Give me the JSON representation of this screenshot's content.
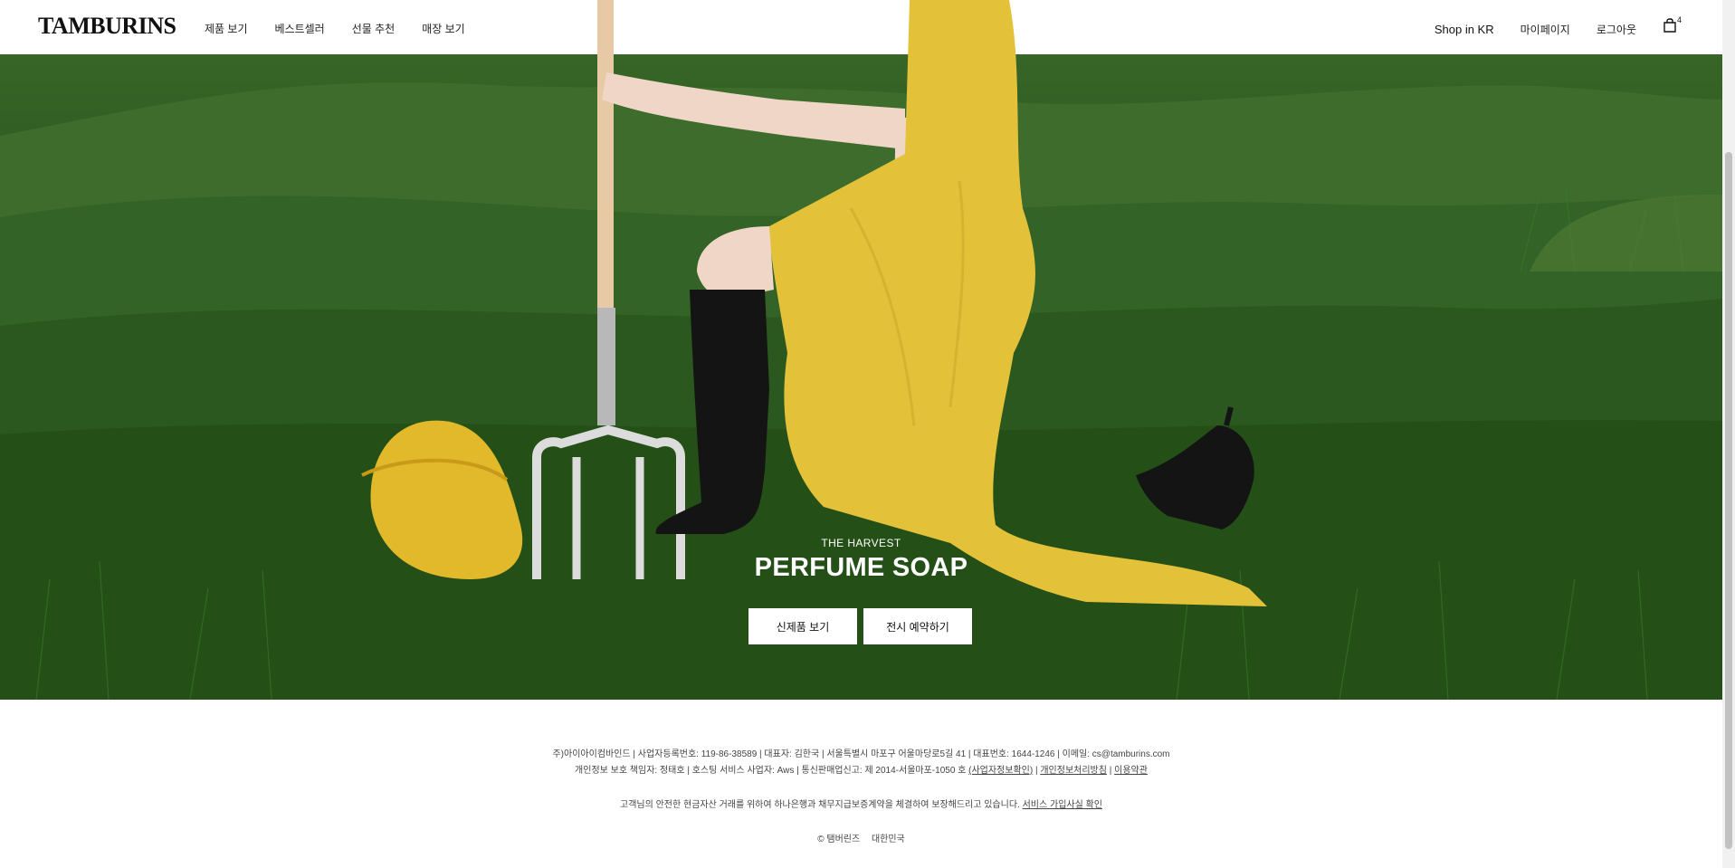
{
  "header": {
    "logo": "TAMBURINS",
    "nav": [
      "제품 보기",
      "베스트셀러",
      "선물 추천",
      "매장 보기"
    ],
    "shop_region": "Shop in KR",
    "mypage": "마이페이지",
    "logout": "로그아웃",
    "cart_count": "4"
  },
  "hero": {
    "eyebrow": "THE HARVEST",
    "headline": "PERFUME SOAP",
    "cta_primary": "신제품 보기",
    "cta_secondary": "전시 예약하기"
  },
  "footer": {
    "line1": "주)아이아이컴바인드 | 사업자등록번호: 119-86-38589 | 대표자: 김한국 | 서울특별시 마포구 어울마당로5길 41 | 대표번호: 1644-1246 | 이메일: cs@tamburins.com",
    "line2_text": "개인정보 보호 책임자: 정태호 | 호스팅 서비스 사업자: Aws | 통신판매업신고: 제 2014-서울마포-1050 호",
    "line2_link1": "(사업자정보확인)",
    "line2_link2": "개인정보처리방침",
    "line2_link3": "이용약관",
    "line3_text": "고객님의 안전한 현금자산 거래를 위하여 하나은행과 채무지급보증계약을 체결하여 보장해드리고 있습니다.",
    "line3_link": "서비스 가입사실 확인",
    "copyright": "© 탬버린즈",
    "country": "대한민국"
  },
  "colors": {
    "grass_dark": "#1f4a14",
    "grass_mid": "#2f5c22",
    "dress_yellow": "#e3c23a",
    "boot_black": "#141414",
    "button_bg": "#ffffff"
  },
  "icons": {
    "cart": "shopping-bag-icon"
  }
}
